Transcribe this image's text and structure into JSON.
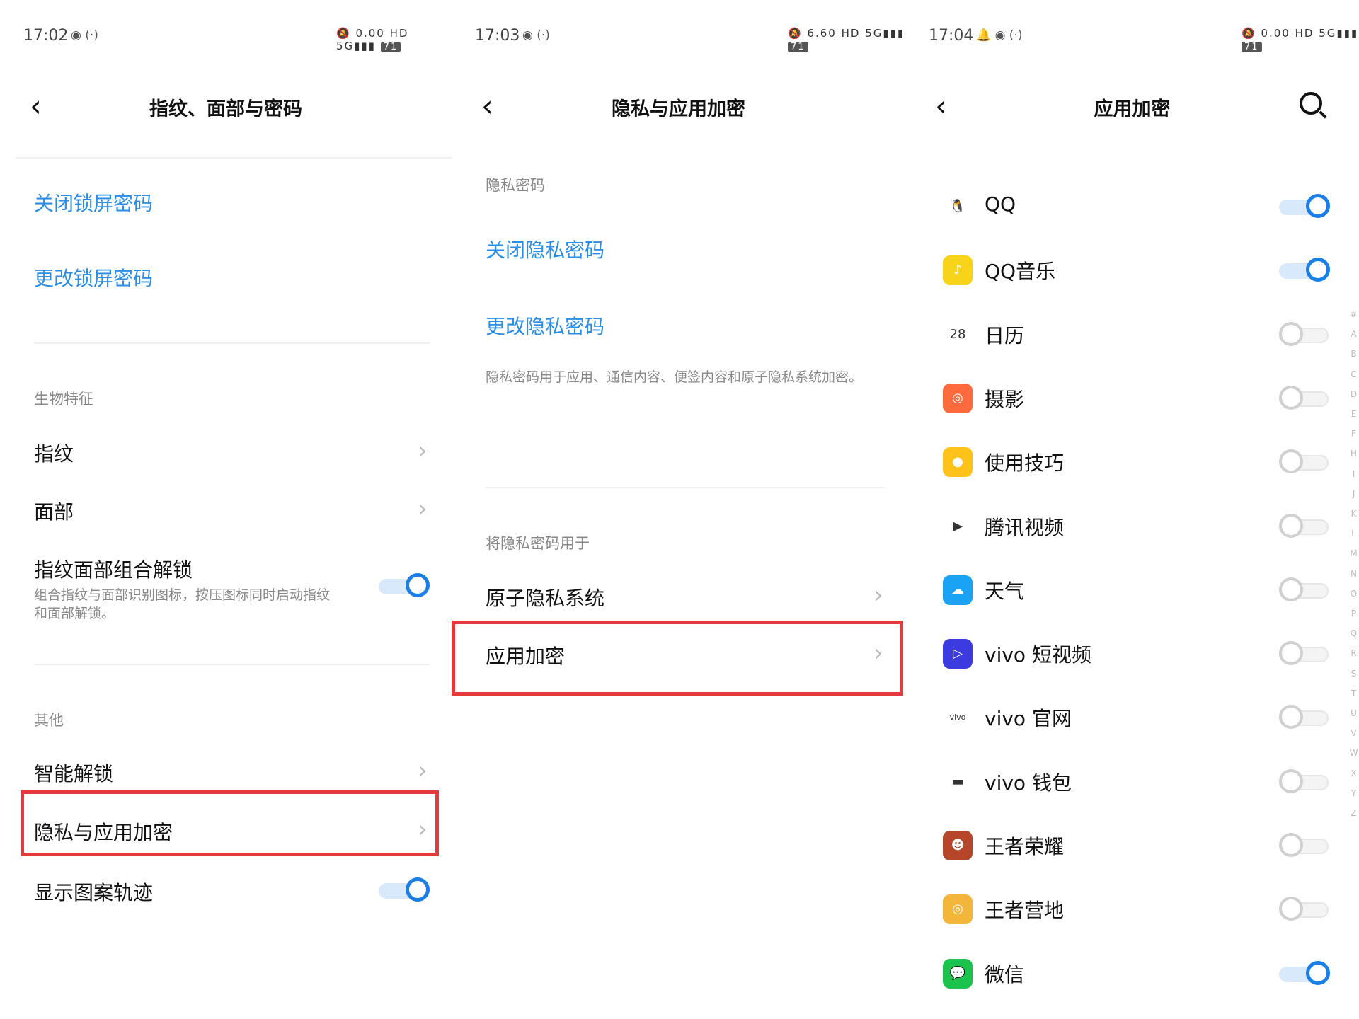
{
  "screen1": {
    "status": {
      "time": "17:02",
      "left_icons": "◉ (·)",
      "right_icons": "🔕 0.00 HD 5G▮▮▮",
      "battery": "71"
    },
    "title": "指纹、面部与密码",
    "close_lock_password": "关闭锁屏密码",
    "change_lock_password": "更改锁屏密码",
    "biometrics_label": "生物特征",
    "fingerprint": "指纹",
    "face": "面部",
    "combo_unlock": "指纹面部组合解锁",
    "combo_desc": "组合指纹与面部识别图标，按压图标同时启动指纹和面部解锁。",
    "combo_on": true,
    "other_label": "其他",
    "smart_unlock": "智能解锁",
    "privacy_encrypt": "隐私与应用加密",
    "show_pattern": "显示图案轨迹",
    "show_pattern_on": true
  },
  "screen2": {
    "status": {
      "time": "17:03",
      "left_icons": "◉ (·)",
      "right_icons": "🔕 6.60 HD 5G▮▮▮",
      "battery": "71"
    },
    "title": "隐私与应用加密",
    "privacy_password_label": "隐私密码",
    "close_privacy_password": "关闭隐私密码",
    "change_privacy_password": "更改隐私密码",
    "privacy_desc": "隐私密码用于应用、通信内容、便签内容和原子隐私系统加密。",
    "use_for_label": "将隐私密码用于",
    "atom_privacy": "原子隐私系统",
    "app_encrypt": "应用加密"
  },
  "screen3": {
    "status": {
      "time": "17:04",
      "left_icons": "🔔 ◉ (·)",
      "right_icons": "🔕 0.00 HD 5G▮▮▮",
      "battery": "71"
    },
    "title": "应用加密",
    "apps": [
      {
        "name": "QQ",
        "on": true,
        "icon": "qq-icon",
        "color": "#ffffff",
        "glyph": "🐧"
      },
      {
        "name": "QQ音乐",
        "on": true,
        "icon": "qq-music-icon",
        "color": "#f7d31a",
        "glyph": "♪"
      },
      {
        "name": "日历",
        "on": false,
        "icon": "calendar-icon",
        "color": "#ffffff",
        "glyph": "28"
      },
      {
        "name": "摄影",
        "on": false,
        "icon": "camera-icon",
        "color": "#ff6a3d",
        "glyph": "◎"
      },
      {
        "name": "使用技巧",
        "on": false,
        "icon": "tips-icon",
        "color": "#ffc21a",
        "glyph": "●"
      },
      {
        "name": "腾讯视频",
        "on": false,
        "icon": "tencent-video-icon",
        "color": "#ffffff",
        "glyph": "▶"
      },
      {
        "name": "天气",
        "on": false,
        "icon": "weather-icon",
        "color": "#1aa3f5",
        "glyph": "☁"
      },
      {
        "name": "vivo 短视频",
        "on": false,
        "icon": "vivo-short-video-icon",
        "color": "#3b3be0",
        "glyph": "▷"
      },
      {
        "name": "vivo 官网",
        "on": false,
        "icon": "vivo-official-icon",
        "color": "#ffffff",
        "glyph": "vivo"
      },
      {
        "name": "vivo 钱包",
        "on": false,
        "icon": "vivo-wallet-icon",
        "color": "#ffffff",
        "glyph": "▬"
      },
      {
        "name": "王者荣耀",
        "on": false,
        "icon": "honor-of-kings-icon",
        "color": "#b5462a",
        "glyph": "☻"
      },
      {
        "name": "王者营地",
        "on": false,
        "icon": "kings-camp-icon",
        "color": "#f3b53a",
        "glyph": "◎"
      },
      {
        "name": "微信",
        "on": true,
        "icon": "wechat-icon",
        "color": "#1bc24b",
        "glyph": "💬"
      }
    ],
    "index_letters": [
      "#",
      "A",
      "B",
      "C",
      "D",
      "E",
      "F",
      "H",
      "I",
      "J",
      "K",
      "L",
      "M",
      "N",
      "O",
      "P",
      "Q",
      "R",
      "S",
      "T",
      "U",
      "V",
      "W",
      "X",
      "Y",
      "Z"
    ]
  },
  "colors": {
    "link": "#2a8ee8",
    "toggle_on": "#1a7fe6",
    "highlight": "#e5393b"
  }
}
